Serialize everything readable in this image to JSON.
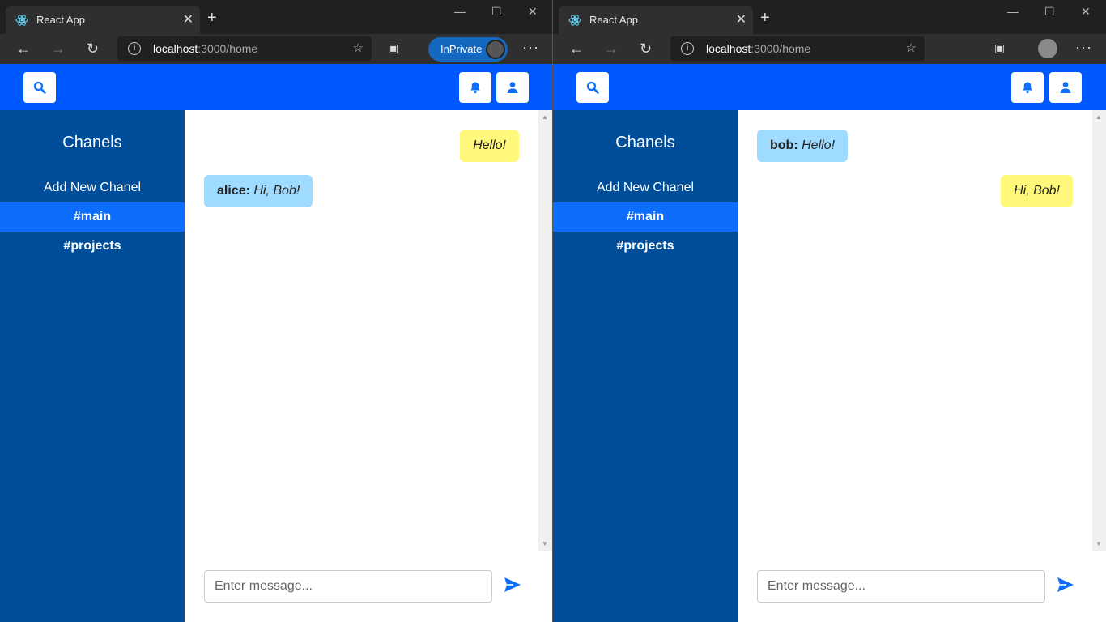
{
  "browser": {
    "tab_title": "React App",
    "url_host": "localhost",
    "url_path": ":3000/home",
    "inprivate_label": "InPrivate"
  },
  "app": {
    "sidebar_title": "Chanels",
    "add_channel_label": "Add New Chanel",
    "channels": [
      "#main",
      "#projects"
    ],
    "active_channel": "#main",
    "input_placeholder": "Enter message...",
    "colors": {
      "header": "#0059ff",
      "sidebar": "#004e99",
      "active_channel": "#0d6efd",
      "own_bubble": "#fff87a",
      "other_bubble": "#9fdbff"
    }
  },
  "windows": [
    {
      "messages": [
        {
          "author": "",
          "text": "Hello!",
          "own": true
        },
        {
          "author": "alice:",
          "text": "Hi, Bob!",
          "own": false
        }
      ]
    },
    {
      "messages": [
        {
          "author": "bob:",
          "text": "Hello!",
          "own": false
        },
        {
          "author": "",
          "text": "Hi, Bob!",
          "own": true
        }
      ]
    }
  ]
}
